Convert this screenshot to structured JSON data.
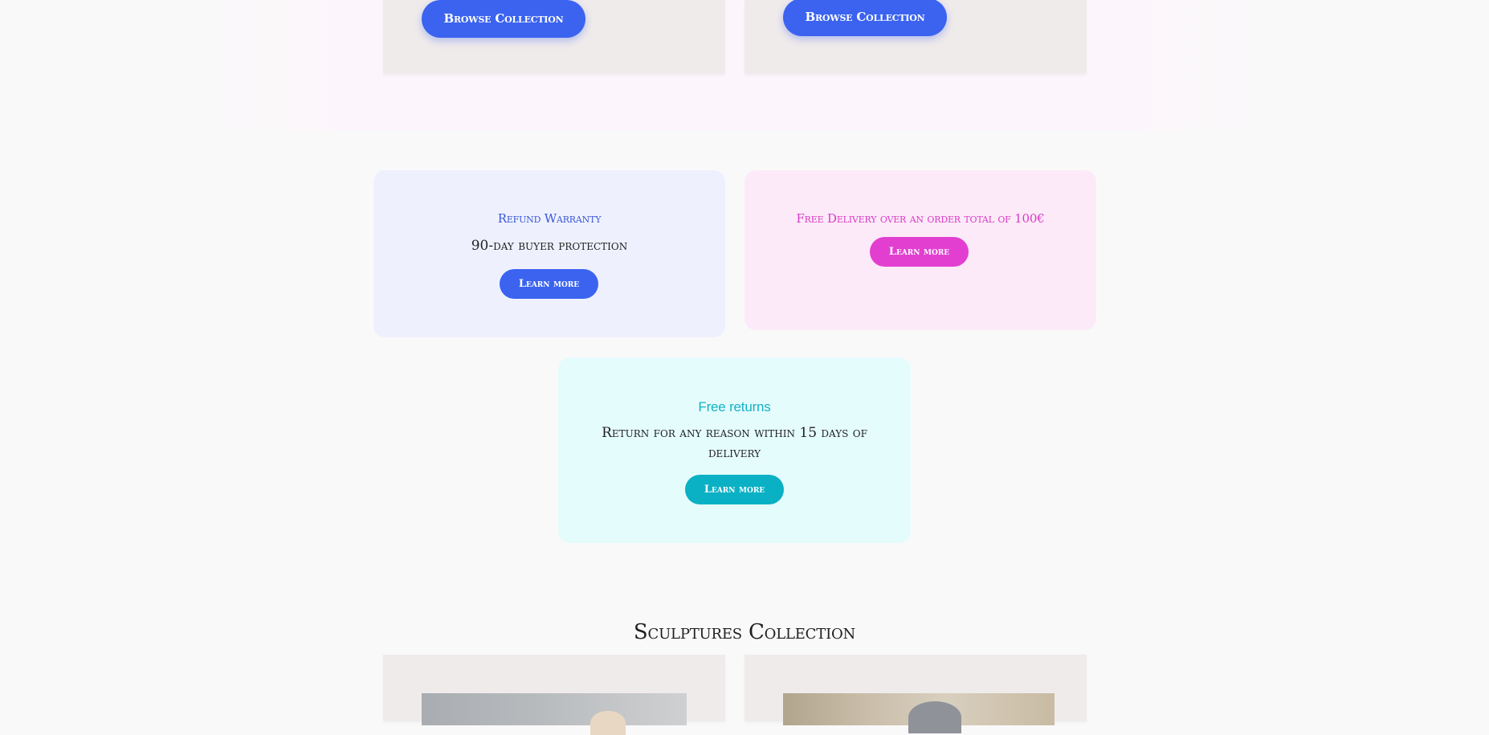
{
  "top_cards": {
    "card_a": {
      "button_label": "Browse Collection"
    },
    "card_b": {
      "button_label": "Browse Collection"
    }
  },
  "info_cards": {
    "refund": {
      "title": "Refund Warranty",
      "text": "90-day buyer protection",
      "button_label": "Learn more"
    },
    "delivery": {
      "title": "Free Delivery over an order total of 100€",
      "button_label": "Learn more"
    },
    "returns": {
      "title": "Free returns",
      "text": "Return for any reason within 15 days of delivery",
      "button_label": "Learn more"
    }
  },
  "sculptures_section": {
    "title": "Sculptures Collection"
  },
  "colors": {
    "page_background": "#faf9f9",
    "primary_blue": "#3b63f0",
    "pink_accent": "#e23fd1",
    "teal_accent": "#0ab0c4",
    "card_background": "#f0ebeb"
  }
}
